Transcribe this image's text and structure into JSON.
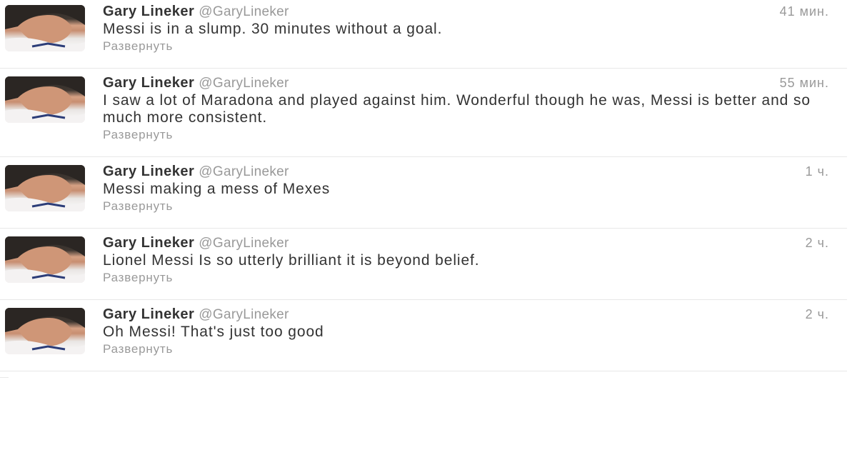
{
  "tweets": [
    {
      "fullname": "Gary Lineker",
      "username": "@GaryLineker",
      "time": "41 мин.",
      "text": "Messi is in a slump. 30 minutes without a goal.",
      "expand": "Развернуть"
    },
    {
      "fullname": "Gary Lineker",
      "username": "@GaryLineker",
      "time": "55 мин.",
      "text": "I saw a lot of Maradona and played against him. Wonderful though he was, Messi is better and so much more consistent.",
      "expand": "Развернуть"
    },
    {
      "fullname": "Gary Lineker",
      "username": "@GaryLineker",
      "time": "1 ч.",
      "text": "Messi making a mess of Mexes",
      "expand": "Развернуть"
    },
    {
      "fullname": "Gary Lineker",
      "username": "@GaryLineker",
      "time": "2 ч.",
      "text": "Lionel Messi Is so utterly brilliant it is beyond belief.",
      "expand": "Развернуть"
    },
    {
      "fullname": "Gary Lineker",
      "username": "@GaryLineker",
      "time": "2 ч.",
      "text": "Oh Messi! That's just too good",
      "expand": "Развернуть"
    }
  ]
}
